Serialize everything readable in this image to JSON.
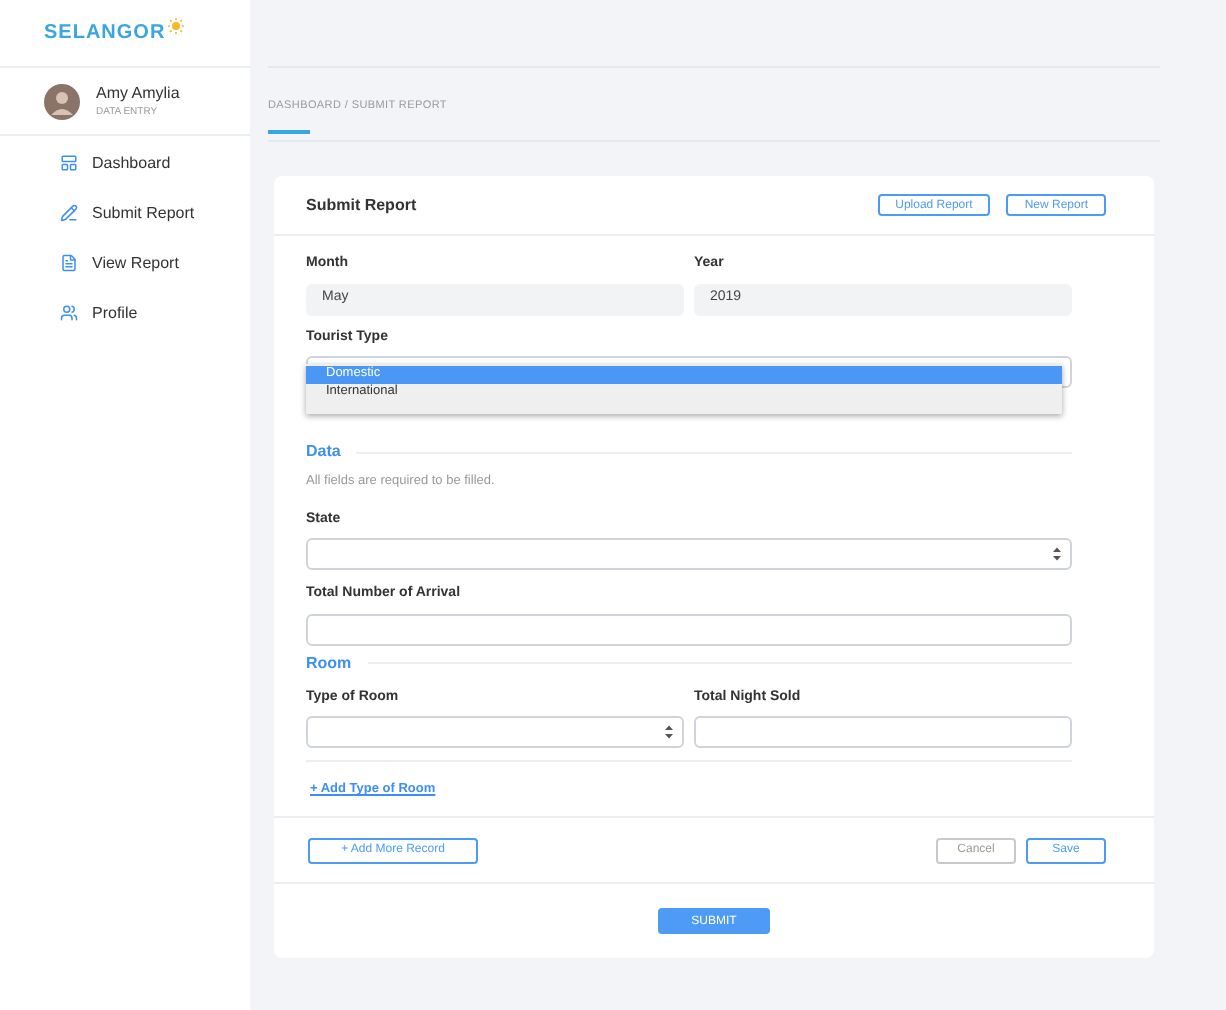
{
  "logo": {
    "text": "SELANGOR"
  },
  "user": {
    "name": "Amy Amylia",
    "role": "DATA ENTRY"
  },
  "sidebar": {
    "items": [
      {
        "label": "Dashboard",
        "selected": false
      },
      {
        "label": "Submit Report",
        "selected": false
      },
      {
        "label": "View Report",
        "selected": false
      },
      {
        "label": "Profile",
        "selected": false
      }
    ]
  },
  "breadcrumb": "DASHBOARD / SUBMIT REPORT",
  "card": {
    "title": "Submit Report",
    "header_buttons": [
      "Upload Report",
      "New Report"
    ]
  },
  "period": [
    {
      "label": "Month",
      "value": "May"
    },
    {
      "label": "Year",
      "value": "2019"
    }
  ],
  "tourist_type": {
    "label": "Tourist Type",
    "options": [
      {
        "label": "Domestic",
        "selected": true
      },
      {
        "label": "International",
        "selected": false
      }
    ]
  },
  "data_section": {
    "heading": "Data",
    "note": "All fields are required to be filled.",
    "fields": [
      {
        "label": "State",
        "kind": "select"
      },
      {
        "label": "Total Number of Arrival",
        "kind": "input"
      }
    ]
  },
  "room_section": {
    "heading": "Room",
    "fields": [
      {
        "label": "Type of Room",
        "kind": "select"
      },
      {
        "label": "Total Night Sold",
        "kind": "input"
      }
    ],
    "add_link": "+ Add Type of Room"
  },
  "actions": {
    "add_record": "+ Add More Record",
    "cancel": "Cancel",
    "save": "Save"
  },
  "submit": "SUBMIT"
}
